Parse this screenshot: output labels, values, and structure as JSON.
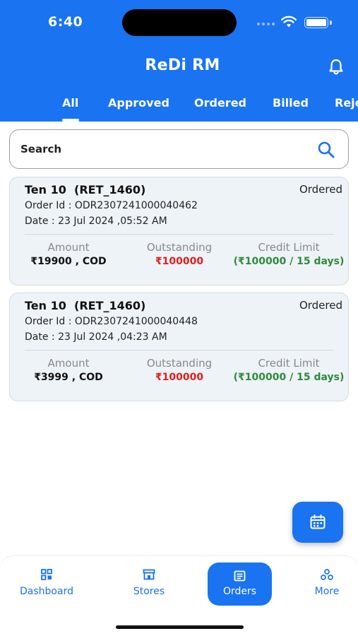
{
  "status_bar": {
    "time": "6:40"
  },
  "header": {
    "title": "ReDi RM"
  },
  "tabs": [
    {
      "label": "All",
      "active": true
    },
    {
      "label": "Approved"
    },
    {
      "label": "Ordered"
    },
    {
      "label": "Billed"
    },
    {
      "label": "Reje"
    }
  ],
  "search": {
    "placeholder": "Search"
  },
  "metric_labels": {
    "amount": "Amount",
    "outstanding": "Outstanding",
    "credit_limit": "Credit Limit"
  },
  "orders": [
    {
      "title": "Ten 10  (RET_1460)",
      "status": "Ordered",
      "order_id": "Order Id : ODR2307241000040462",
      "date": "Date : 23 Jul 2024 ,05:52 AM",
      "amount": "₹19900 , COD",
      "outstanding": "₹100000",
      "credit_limit": "(₹100000 / 15 days)"
    },
    {
      "title": "Ten 10  (RET_1460)",
      "status": "Ordered",
      "order_id": "Order Id : ODR2307241000040448",
      "date": "Date : 23 Jul 2024 ,04:23 AM",
      "amount": "₹3999 , COD",
      "outstanding": "₹100000",
      "credit_limit": "(₹100000 / 15 days)"
    }
  ],
  "bottom_nav": [
    {
      "label": "Dashboard",
      "icon": "dashboard-icon"
    },
    {
      "label": "Stores",
      "icon": "store-icon"
    },
    {
      "label": "Orders",
      "icon": "orders-icon",
      "active": true
    },
    {
      "label": "More",
      "icon": "more-icon"
    }
  ],
  "colors": {
    "primary": "#1A73F0",
    "outstanding": "#E0201B",
    "credit": "#2E8B3A",
    "card_bg": "#EEF3F8"
  }
}
